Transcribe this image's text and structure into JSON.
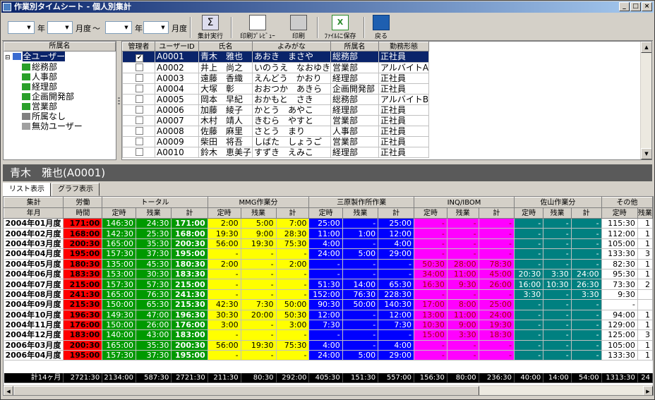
{
  "window": {
    "title": "作業別タイムシート - 個人別集計"
  },
  "toolbar": {
    "year_label": "年",
    "month_label": "月度",
    "tilde": "〜",
    "buttons": {
      "aggregate": "集計実行",
      "preview": "印刷ﾌﾟﾚﾋﾞｭｰ",
      "print": "印刷",
      "save": "ﾌｧｲﾙに保存",
      "back": "戻る"
    }
  },
  "tree": {
    "header": "所属名",
    "items": [
      {
        "label": "全ユーザー"
      },
      {
        "label": "総務部"
      },
      {
        "label": "人事部"
      },
      {
        "label": "経理部"
      },
      {
        "label": "企画開発部"
      },
      {
        "label": "営業部"
      },
      {
        "label": "所属なし"
      },
      {
        "label": "無効ユーザー"
      }
    ]
  },
  "users": {
    "headers": [
      "管理者",
      "ユーザーID",
      "氏名",
      "よみがな",
      "所属名",
      "勤務形態"
    ],
    "rows": [
      {
        "admin": true,
        "id": "A0001",
        "name": "青木　雅也",
        "kana": "あおき　まさや",
        "dept": "総務部",
        "type": "正社員"
      },
      {
        "admin": false,
        "id": "A0002",
        "name": "井上　尚之",
        "kana": "いのうえ　なおゆき",
        "dept": "営業部",
        "type": "アルバイトA"
      },
      {
        "admin": false,
        "id": "A0003",
        "name": "遠藤　香織",
        "kana": "えんどう　かおり",
        "dept": "経理部",
        "type": "正社員"
      },
      {
        "admin": false,
        "id": "A0004",
        "name": "大塚　彰",
        "kana": "おおつか　あきら",
        "dept": "企画開発部",
        "type": "正社員"
      },
      {
        "admin": false,
        "id": "A0005",
        "name": "岡本　早紀",
        "kana": "おかもと　さき",
        "dept": "総務部",
        "type": "アルバイトB"
      },
      {
        "admin": false,
        "id": "A0006",
        "name": "加藤　綾子",
        "kana": "かとう　あやこ",
        "dept": "経理部",
        "type": "正社員"
      },
      {
        "admin": false,
        "id": "A0007",
        "name": "木村　靖人",
        "kana": "きむら　やすと",
        "dept": "営業部",
        "type": "正社員"
      },
      {
        "admin": false,
        "id": "A0008",
        "name": "佐藤　麻里",
        "kana": "さとう　まり",
        "dept": "人事部",
        "type": "正社員"
      },
      {
        "admin": false,
        "id": "A0009",
        "name": "柴田　将吾",
        "kana": "しばた　しょうご",
        "dept": "営業部",
        "type": "正社員"
      },
      {
        "admin": false,
        "id": "A0010",
        "name": "鈴木　恵美子",
        "kana": "すずき　えみこ",
        "dept": "経理部",
        "type": "正社員"
      }
    ]
  },
  "selected_user": "青木　雅也(A0001)",
  "tabs": [
    {
      "label": "リスト表示"
    },
    {
      "label": "グラフ表示"
    }
  ],
  "sheet": {
    "head_aggregate": "集計",
    "head_ym": "年月",
    "head_labor": "労働",
    "head_time": "時間",
    "groups": [
      "トータル",
      "MMG作業分",
      "三原製作所作業",
      "INQ/IBOM",
      "佐山作業分",
      "その他"
    ],
    "sub": [
      "定時",
      "残業",
      "計"
    ],
    "colors": {
      "labor": "#ff0000",
      "total": "#009900",
      "mmg": "#ffff00",
      "mihara": "#0000ff",
      "inq": "#ff00ff",
      "sayama": "#008080",
      "other": "#ffffff"
    },
    "rows": [
      [
        "2004年01月度",
        "171:00",
        "146:30",
        "24:30",
        "171:00",
        "2:00",
        "5:00",
        "7:00",
        "25:00",
        "-",
        "25:00",
        "-",
        "-",
        "-",
        "-",
        "-",
        "-",
        "115:30",
        "1"
      ],
      [
        "2004年02月度",
        "168:00",
        "142:30",
        "25:30",
        "168:00",
        "19:30",
        "9:00",
        "28:30",
        "11:00",
        "1:00",
        "12:00",
        "-",
        "-",
        "-",
        "-",
        "-",
        "-",
        "112:00",
        "1"
      ],
      [
        "2004年03月度",
        "200:30",
        "165:00",
        "35:30",
        "200:30",
        "56:00",
        "19:30",
        "75:30",
        "4:00",
        "-",
        "4:00",
        "-",
        "-",
        "-",
        "-",
        "-",
        "-",
        "105:00",
        "1"
      ],
      [
        "2004年04月度",
        "195:00",
        "157:30",
        "37:30",
        "195:00",
        "-",
        "-",
        "-",
        "24:00",
        "5:00",
        "29:00",
        "-",
        "-",
        "-",
        "-",
        "-",
        "-",
        "133:30",
        "3"
      ],
      [
        "2004年05月度",
        "180:30",
        "135:00",
        "45:30",
        "180:30",
        "2:00",
        "-",
        "2:00",
        "-",
        "-",
        "-",
        "50:30",
        "28:00",
        "78:30",
        "-",
        "-",
        "-",
        "82:30",
        "1"
      ],
      [
        "2004年06月度",
        "183:30",
        "153:00",
        "30:30",
        "183:30",
        "-",
        "-",
        "-",
        "-",
        "-",
        "-",
        "34:00",
        "11:00",
        "45:00",
        "20:30",
        "3:30",
        "24:00",
        "95:30",
        "1"
      ],
      [
        "2004年07月度",
        "215:00",
        "157:30",
        "57:30",
        "215:00",
        "-",
        "-",
        "-",
        "51:30",
        "14:00",
        "65:30",
        "16:30",
        "9:30",
        "26:00",
        "16:00",
        "10:30",
        "26:30",
        "73:30",
        "2"
      ],
      [
        "2004年08月度",
        "241:30",
        "165:00",
        "76:30",
        "241:30",
        "-",
        "-",
        "-",
        "152:00",
        "76:30",
        "228:30",
        "-",
        "-",
        "-",
        "3:30",
        "-",
        "3:30",
        "9:30",
        ""
      ],
      [
        "2004年09月度",
        "215:30",
        "150:00",
        "65:30",
        "215:30",
        "42:30",
        "7:30",
        "50:00",
        "90:30",
        "50:00",
        "140:30",
        "17:00",
        "8:00",
        "25:00",
        "-",
        "-",
        "-",
        "-",
        ""
      ],
      [
        "2004年10月度",
        "196:30",
        "149:30",
        "47:00",
        "196:30",
        "30:30",
        "20:00",
        "50:30",
        "12:00",
        "-",
        "12:00",
        "13:00",
        "11:00",
        "24:00",
        "-",
        "-",
        "-",
        "94:00",
        "1"
      ],
      [
        "2004年11月度",
        "176:00",
        "150:00",
        "26:00",
        "176:00",
        "3:00",
        "-",
        "3:00",
        "7:30",
        "-",
        "7:30",
        "10:30",
        "9:00",
        "19:30",
        "-",
        "-",
        "-",
        "129:00",
        "1"
      ],
      [
        "2004年12月度",
        "183:00",
        "140:00",
        "43:00",
        "183:00",
        "-",
        "-",
        "-",
        "-",
        "-",
        "-",
        "15:00",
        "3:30",
        "18:30",
        "-",
        "-",
        "-",
        "125:00",
        "3"
      ],
      [
        "2006年03月度",
        "200:30",
        "165:00",
        "35:30",
        "200:30",
        "56:00",
        "19:30",
        "75:30",
        "4:00",
        "-",
        "4:00",
        "-",
        "-",
        "-",
        "-",
        "-",
        "-",
        "105:00",
        "1"
      ],
      [
        "2006年04月度",
        "195:00",
        "157:30",
        "37:30",
        "195:00",
        "-",
        "-",
        "-",
        "24:00",
        "5:00",
        "29:00",
        "-",
        "-",
        "-",
        "-",
        "-",
        "-",
        "133:30",
        "1"
      ]
    ],
    "total": [
      "計14ヶ月",
      "2721:30",
      "2134:00",
      "587:30",
      "2721:30",
      "211:30",
      "80:30",
      "292:00",
      "405:30",
      "151:30",
      "557:00",
      "156:30",
      "80:00",
      "236:30",
      "40:00",
      "14:00",
      "54:00",
      "1313:30",
      "24"
    ]
  }
}
